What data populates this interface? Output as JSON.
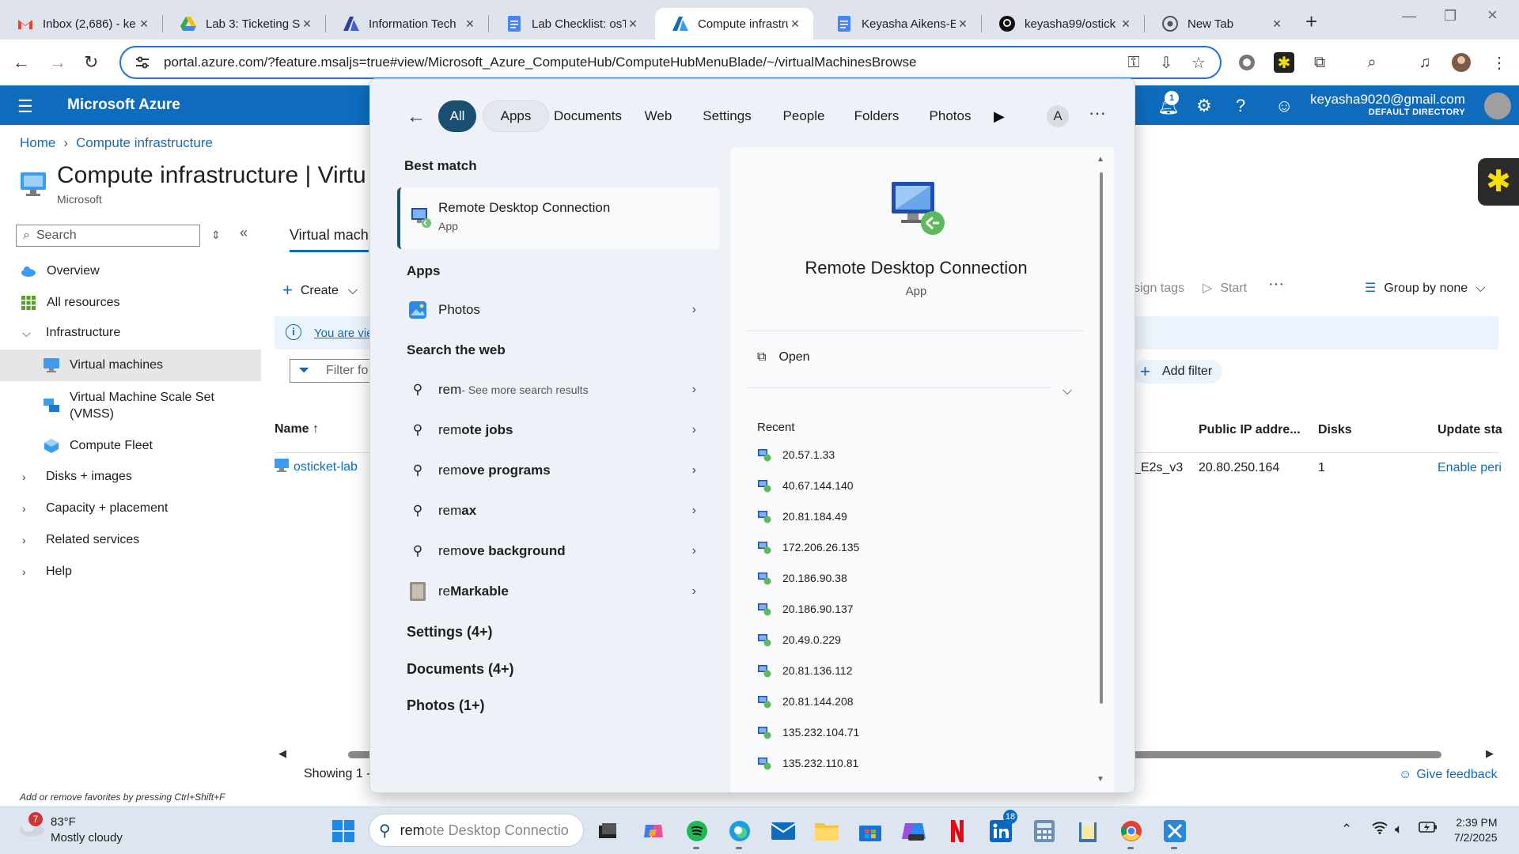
{
  "browser": {
    "tabs": [
      {
        "title": "Inbox (2,686) - ke",
        "icon": "gmail-icon"
      },
      {
        "title": "Lab 3: Ticketing S",
        "icon": "google-drive-icon"
      },
      {
        "title": "Information Tech",
        "icon": "azure-icon"
      },
      {
        "title": "Lab Checklist: osT",
        "icon": "docs-icon"
      },
      {
        "title": "Compute infrastru",
        "icon": "azure-icon"
      },
      {
        "title": "Keyasha Aikens-E",
        "icon": "docs-icon"
      },
      {
        "title": "keyasha99/ostick",
        "icon": "github-icon"
      },
      {
        "title": "New Tab",
        "icon": "chrome-icon"
      }
    ],
    "active_tab": 4,
    "url": "portal.azure.com/?feature.msaljs=true#view/Microsoft_Azure_ComputeHub/ComputeHubMenuBlade/~/virtualMachinesBrowse"
  },
  "azure": {
    "brand": "Microsoft Azure",
    "notification_count": "1",
    "account_email": "keyasha9020@gmail.com",
    "account_directory": "DEFAULT DIRECTORY",
    "breadcrumb": [
      "Home",
      "Compute infrastructure"
    ],
    "page_title": "Compute infrastructure | Virtu",
    "page_subtitle": "Microsoft",
    "search_placeholder": "Search",
    "nav": [
      {
        "label": "Overview"
      },
      {
        "label": "All resources"
      },
      {
        "label": "Infrastructure"
      },
      {
        "label": "Virtual machines"
      },
      {
        "label": "Virtual Machine Scale Set\n(VMSS)"
      },
      {
        "label": "Compute Fleet"
      },
      {
        "label": "Disks + images"
      },
      {
        "label": "Capacity + placement"
      },
      {
        "label": "Related services"
      },
      {
        "label": "Help"
      }
    ],
    "tab_label": "Virtual mach",
    "create_label": "Create",
    "assign_tags_label": "sign tags",
    "start_label": "Start",
    "group_by_label": "Group by none",
    "info_link": "You are vie",
    "filter_placeholder": "Filter fo",
    "add_filter_label": "Add filter",
    "columns": {
      "name": "Name",
      "size": "",
      "public_ip": "Public IP addre...",
      "disks": "Disks",
      "update": "Update sta"
    },
    "row": {
      "name": "osticket-lab",
      "size": "_E2s_v3",
      "public_ip": "20.80.250.164",
      "disks": "1",
      "update": "Enable peri"
    },
    "showing": "Showing 1 -",
    "favorites_hint": "Add or remove favorites by pressing Ctrl+Shift+F",
    "give_feedback": "Give feedback"
  },
  "start_menu": {
    "filters": [
      "All",
      "Apps",
      "Documents",
      "Web",
      "Settings",
      "People",
      "Folders",
      "Photos"
    ],
    "active_filter": "All",
    "avatar_letter": "A",
    "best_match_heading": "Best match",
    "best_match": {
      "name": "Remote Desktop Connection",
      "type": "App"
    },
    "apps_heading": "Apps",
    "apps": [
      {
        "name": "Photos"
      }
    ],
    "web_heading": "Search the web",
    "web_results": [
      {
        "typed": "rem",
        "rest": "",
        "suffix": " - See more search results"
      },
      {
        "typed": "rem",
        "rest": "ote jobs",
        "suffix": ""
      },
      {
        "typed": "rem",
        "rest": "ove programs",
        "suffix": ""
      },
      {
        "typed": "rem",
        "rest": "ax",
        "suffix": ""
      },
      {
        "typed": "rem",
        "rest": "ove background",
        "suffix": ""
      }
    ],
    "remarkable": {
      "typed": "re",
      "rest": "Markable"
    },
    "more_groups": [
      "Settings (4+)",
      "Documents (4+)",
      "Photos (1+)"
    ],
    "detail": {
      "title": "Remote Desktop Connection",
      "type": "App",
      "open_label": "Open",
      "recent_heading": "Recent"
    },
    "recent": [
      "20.57.1.33",
      "40.67.144.140",
      "20.81.184.49",
      "172.206.26.135",
      "20.186.90.38",
      "20.186.90.137",
      "20.49.0.229",
      "20.81.136.112",
      "20.81.144.208",
      "135.232.104.71",
      "135.232.110.81"
    ]
  },
  "taskbar": {
    "weather_badge": "7",
    "temperature": "83°F",
    "condition": "Mostly cloudy",
    "search_typed": "rem",
    "search_suggest": "ote Desktop Connectio",
    "linkedin_badge": "18",
    "time": "2:39 PM",
    "date": "7/2/2025"
  }
}
